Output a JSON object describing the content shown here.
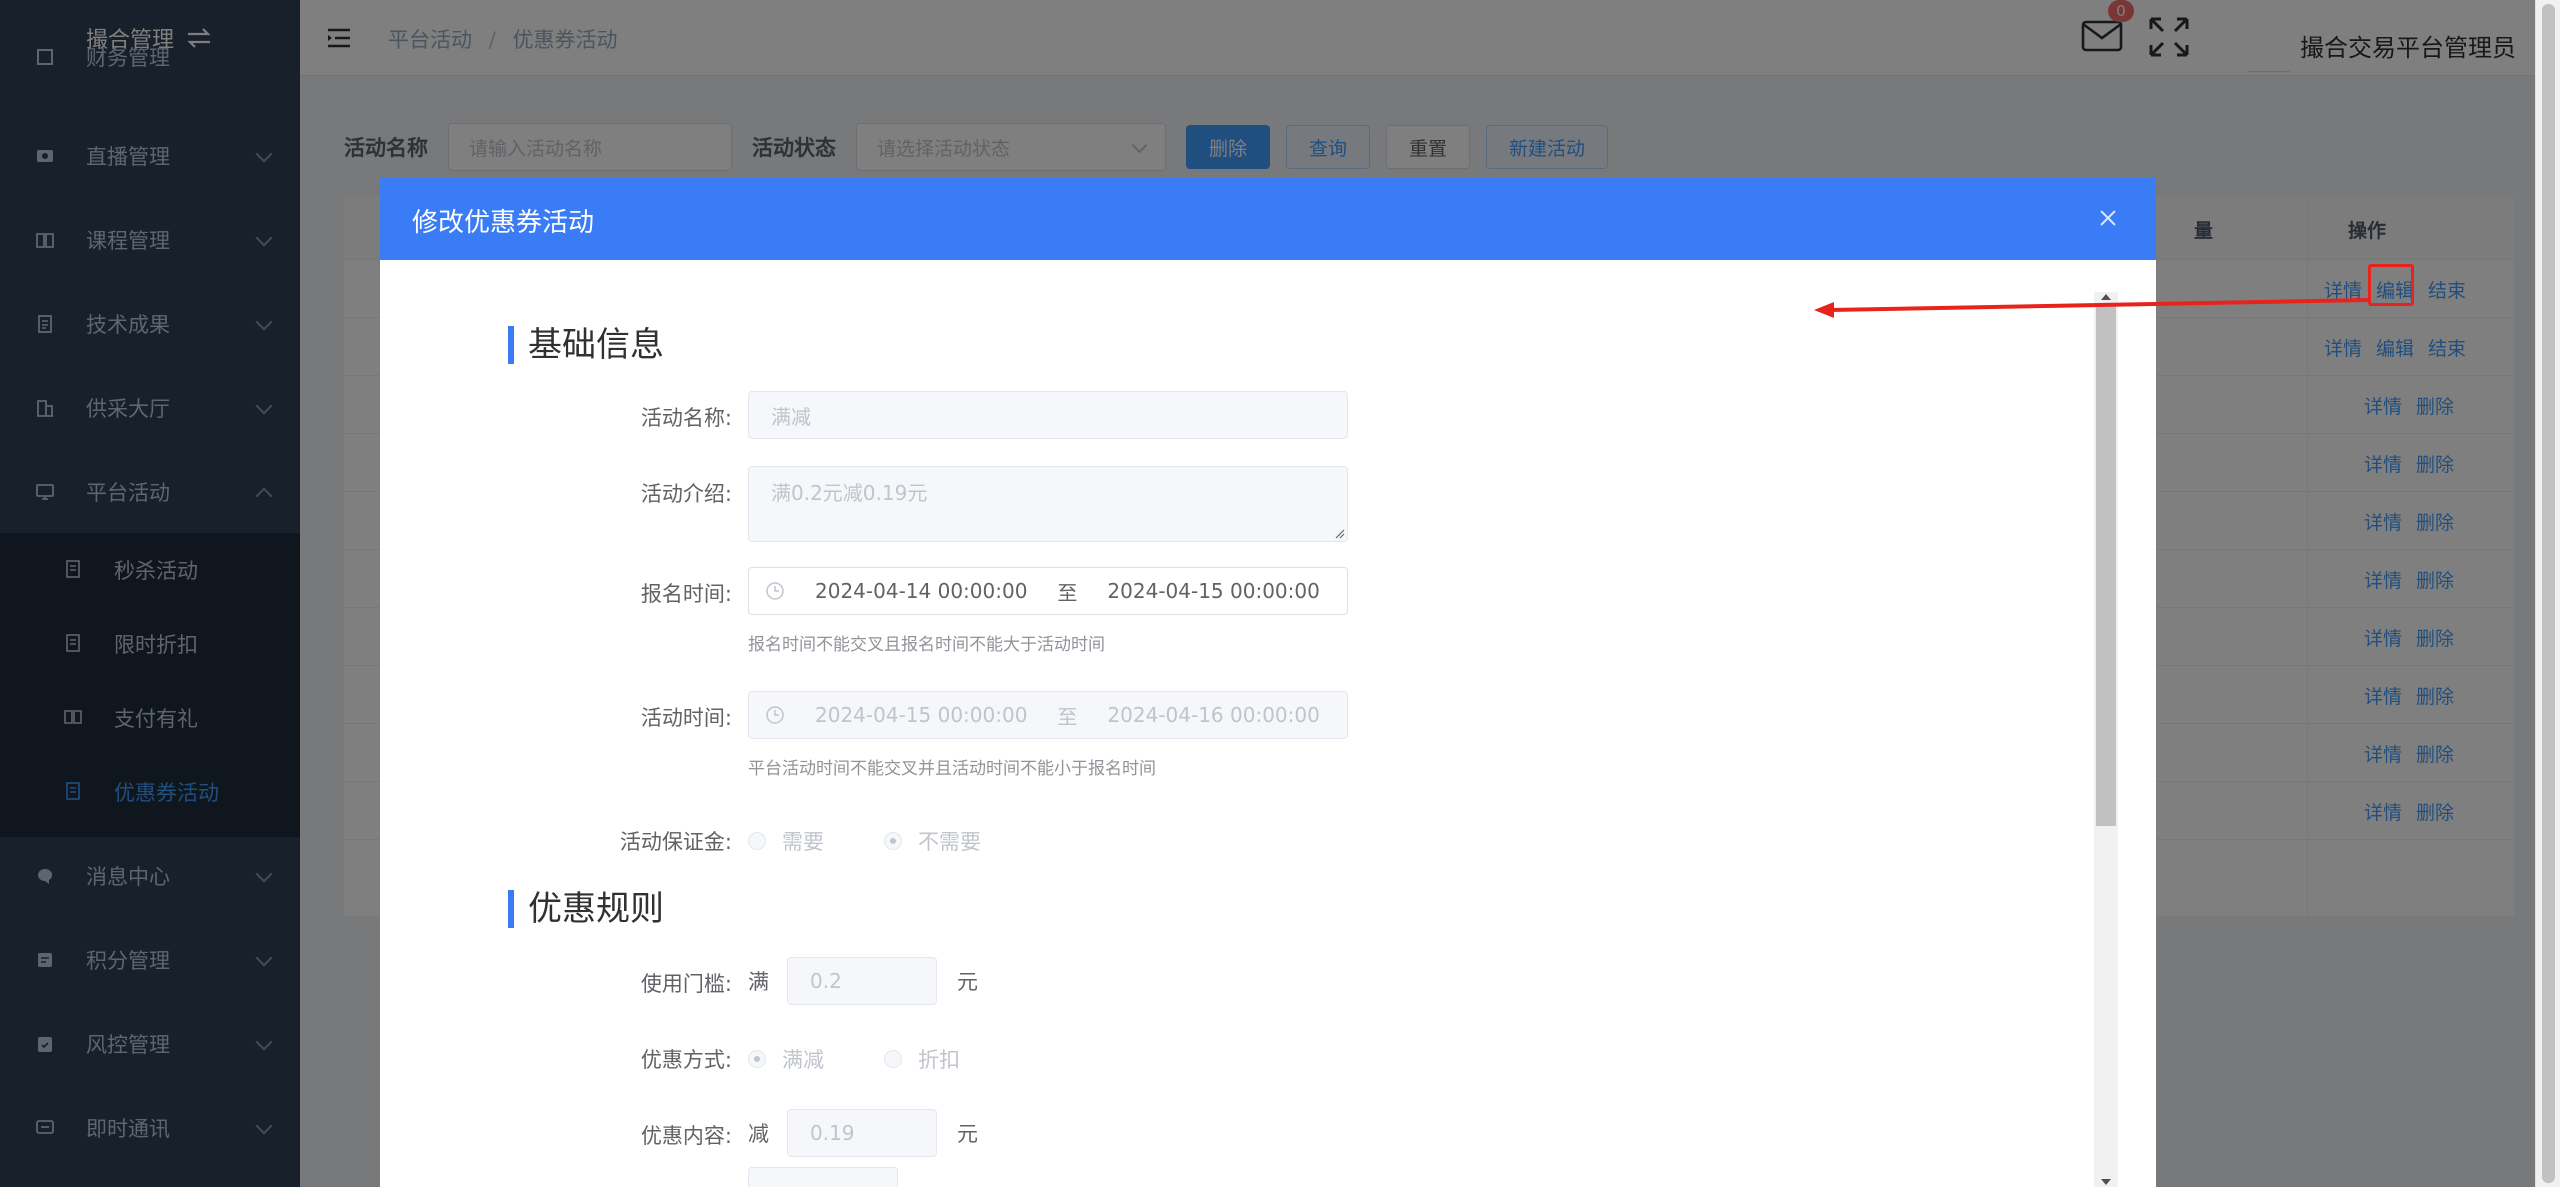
{
  "sidebar": {
    "title": "撮合管理",
    "items": [
      {
        "label": "财务管理",
        "icon": "finance-icon"
      },
      {
        "label": "直播管理",
        "icon": "live-icon"
      },
      {
        "label": "课程管理",
        "icon": "book-icon"
      },
      {
        "label": "技术成果",
        "icon": "document-icon"
      },
      {
        "label": "供采大厅",
        "icon": "building-icon"
      },
      {
        "label": "平台活动",
        "icon": "monitor-icon"
      },
      {
        "label": "消息中心",
        "icon": "chat-icon"
      },
      {
        "label": "积分管理",
        "icon": "points-icon"
      },
      {
        "label": "风控管理",
        "icon": "risk-icon"
      },
      {
        "label": "即时通讯",
        "icon": "message-icon"
      }
    ],
    "subitems": [
      {
        "label": "秒杀活动"
      },
      {
        "label": "限时折扣"
      },
      {
        "label": "支付有礼"
      },
      {
        "label": "优惠券活动"
      }
    ]
  },
  "header": {
    "breadcrumb": [
      "平台活动",
      "优惠券活动"
    ],
    "badge_count": "0",
    "username": "撮合交易平台管理员"
  },
  "filter": {
    "name_label": "活动名称",
    "name_placeholder": "请输入活动名称",
    "status_label": "活动状态",
    "status_placeholder": "请选择活动状态",
    "btn_delete": "删除",
    "btn_query": "查询",
    "btn_reset": "重置",
    "btn_new": "新建活动"
  },
  "table": {
    "col_qty": "量",
    "col_ops": "操作",
    "rows": [
      {
        "ops": [
          "详情",
          "编辑",
          "结束"
        ]
      },
      {
        "ops": [
          "详情",
          "编辑",
          "结束"
        ]
      },
      {
        "ops": [
          "详情",
          "删除"
        ]
      },
      {
        "ops": [
          "详情",
          "删除"
        ]
      },
      {
        "ops": [
          "详情",
          "删除"
        ]
      },
      {
        "ops": [
          "详情",
          "删除"
        ]
      },
      {
        "ops": [
          "详情",
          "删除"
        ]
      },
      {
        "ops": [
          "详情",
          "删除"
        ]
      },
      {
        "ops": [
          "详情",
          "删除"
        ]
      },
      {
        "ops": [
          "详情",
          "删除"
        ]
      }
    ]
  },
  "dialog": {
    "title": "修改优惠券活动",
    "section_basic": "基础信息",
    "section_rules": "优惠规则",
    "name_label": "活动名称:",
    "name_value": "满减",
    "intro_label": "活动介绍:",
    "intro_value": "满0.2元减0.19元",
    "signup_label": "报名时间:",
    "signup_start": "2024-04-14 00:00:00",
    "signup_end": "2024-04-15 00:00:00",
    "range_sep": "至",
    "signup_hint": "报名时间不能交叉且报名时间不能大于活动时间",
    "activity_label": "活动时间:",
    "activity_start": "2024-04-15 00:00:00",
    "activity_end": "2024-04-16 00:00:00",
    "activity_hint": "平台活动时间不能交叉并且活动时间不能小于报名时间",
    "deposit_label": "活动保证金:",
    "deposit_options": [
      "需要",
      "不需要"
    ],
    "threshold_label": "使用门槛:",
    "threshold_prefix": "满",
    "threshold_value": "0.2",
    "unit": "元",
    "method_label": "优惠方式:",
    "method_options": [
      "满减",
      "折扣"
    ],
    "content_label": "优惠内容:",
    "content_prefix": "减",
    "content_value": "0.19"
  },
  "colors": {
    "sidebar_bg": "#304156",
    "accent": "#409eff",
    "dialog_header": "#3a7cf5",
    "annotation": "#e8231d"
  }
}
